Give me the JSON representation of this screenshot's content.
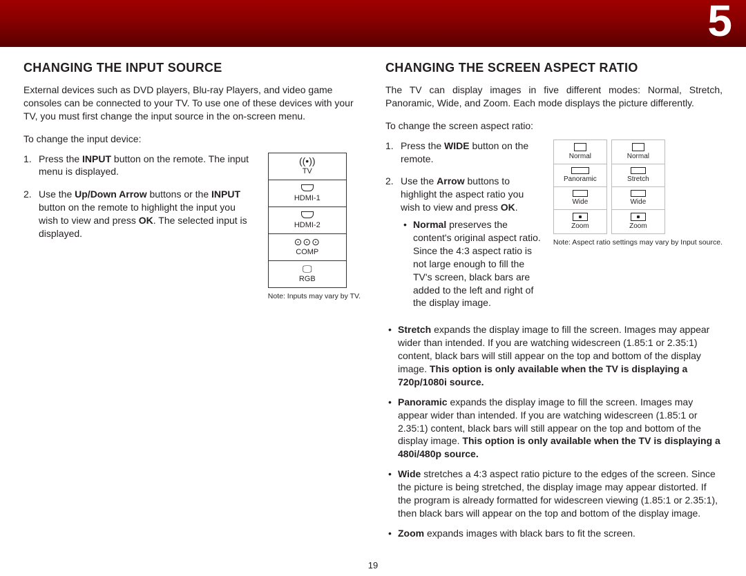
{
  "chapter": "5",
  "page_number": "19",
  "left": {
    "heading": "Changing the Input Source",
    "intro": "External devices such as DVD players, Blu-ray Players, and video game consoles can be connected to your TV. To use one of these devices with your TV, you must first change the input source in the on-screen menu.",
    "lead": "To change the input device:",
    "steps": [
      {
        "pre": "Press the ",
        "bold1": "INPUT",
        "post": " button on the remote. The input menu is displayed."
      },
      {
        "pre": "Use the ",
        "bold1": "Up/Down Arrow",
        "mid1": " buttons or the ",
        "bold2": "INPUT",
        "mid2": " button on the remote to highlight the input you wish to view and press ",
        "bold3": "OK",
        "post": ". The selected input is displayed."
      }
    ],
    "inputs": [
      "TV",
      "HDMI-1",
      "HDMI-2",
      "COMP",
      "RGB"
    ],
    "note": "Note: Inputs may vary by TV."
  },
  "right": {
    "heading": "Changing the Screen Aspect Ratio",
    "intro": "The TV can display images in five different modes: Normal, Stretch, Panoramic, Wide, and Zoom. Each mode displays the picture differently.",
    "lead": "To change the screen aspect ratio:",
    "steps": [
      {
        "pre": "Press the ",
        "bold1": "WIDE",
        "post": " button on the remote."
      },
      {
        "pre": "Use the ",
        "bold1": "Arrow",
        "mid1": " buttons to highlight the aspect ratio you wish to view and press ",
        "bold2": "OK",
        "post": "."
      }
    ],
    "bullets": [
      {
        "name": "Normal",
        "text": " preserves the content's original aspect ratio. Since the 4:3 aspect ratio is not large enough to fill the TV's screen, black bars are added to the left and right of the display image."
      },
      {
        "name": "Stretch",
        "text": " expands the display image to fill the screen. Images may appear wider than intended. If you are watching widescreen (1.85:1 or 2.35:1) content, black bars will still appear on the top and bottom of the display image. ",
        "boldtail": "This option is only available when the TV is displaying a 720p/1080i source."
      },
      {
        "name": "Panoramic",
        "text": " expands the display image to fill the screen. Images may appear wider than intended. If you are watching widescreen (1.85:1 or 2.35:1) content, black bars will still appear on the top and bottom of the display image. ",
        "boldtail": "This option is only available when the TV is displaying a 480i/480p source."
      },
      {
        "name": "Wide",
        "text": " stretches a 4:3 aspect ratio picture to the edges of the screen. Since the picture is being stretched, the display image may appear distorted. If the program is already formatted for widescreen viewing (1.85:1 or 2.35:1), then black bars will appear on the top and bottom of the display image."
      },
      {
        "name": "Zoom",
        "text": " expands images with black bars to fit the screen."
      }
    ],
    "panelA": [
      "Normal",
      "Panoramic",
      "Wide",
      "Zoom"
    ],
    "panelB": [
      "Normal",
      "Stretch",
      "Wide",
      "Zoom"
    ],
    "note": "Note: Aspect ratio settings may vary by Input source."
  }
}
